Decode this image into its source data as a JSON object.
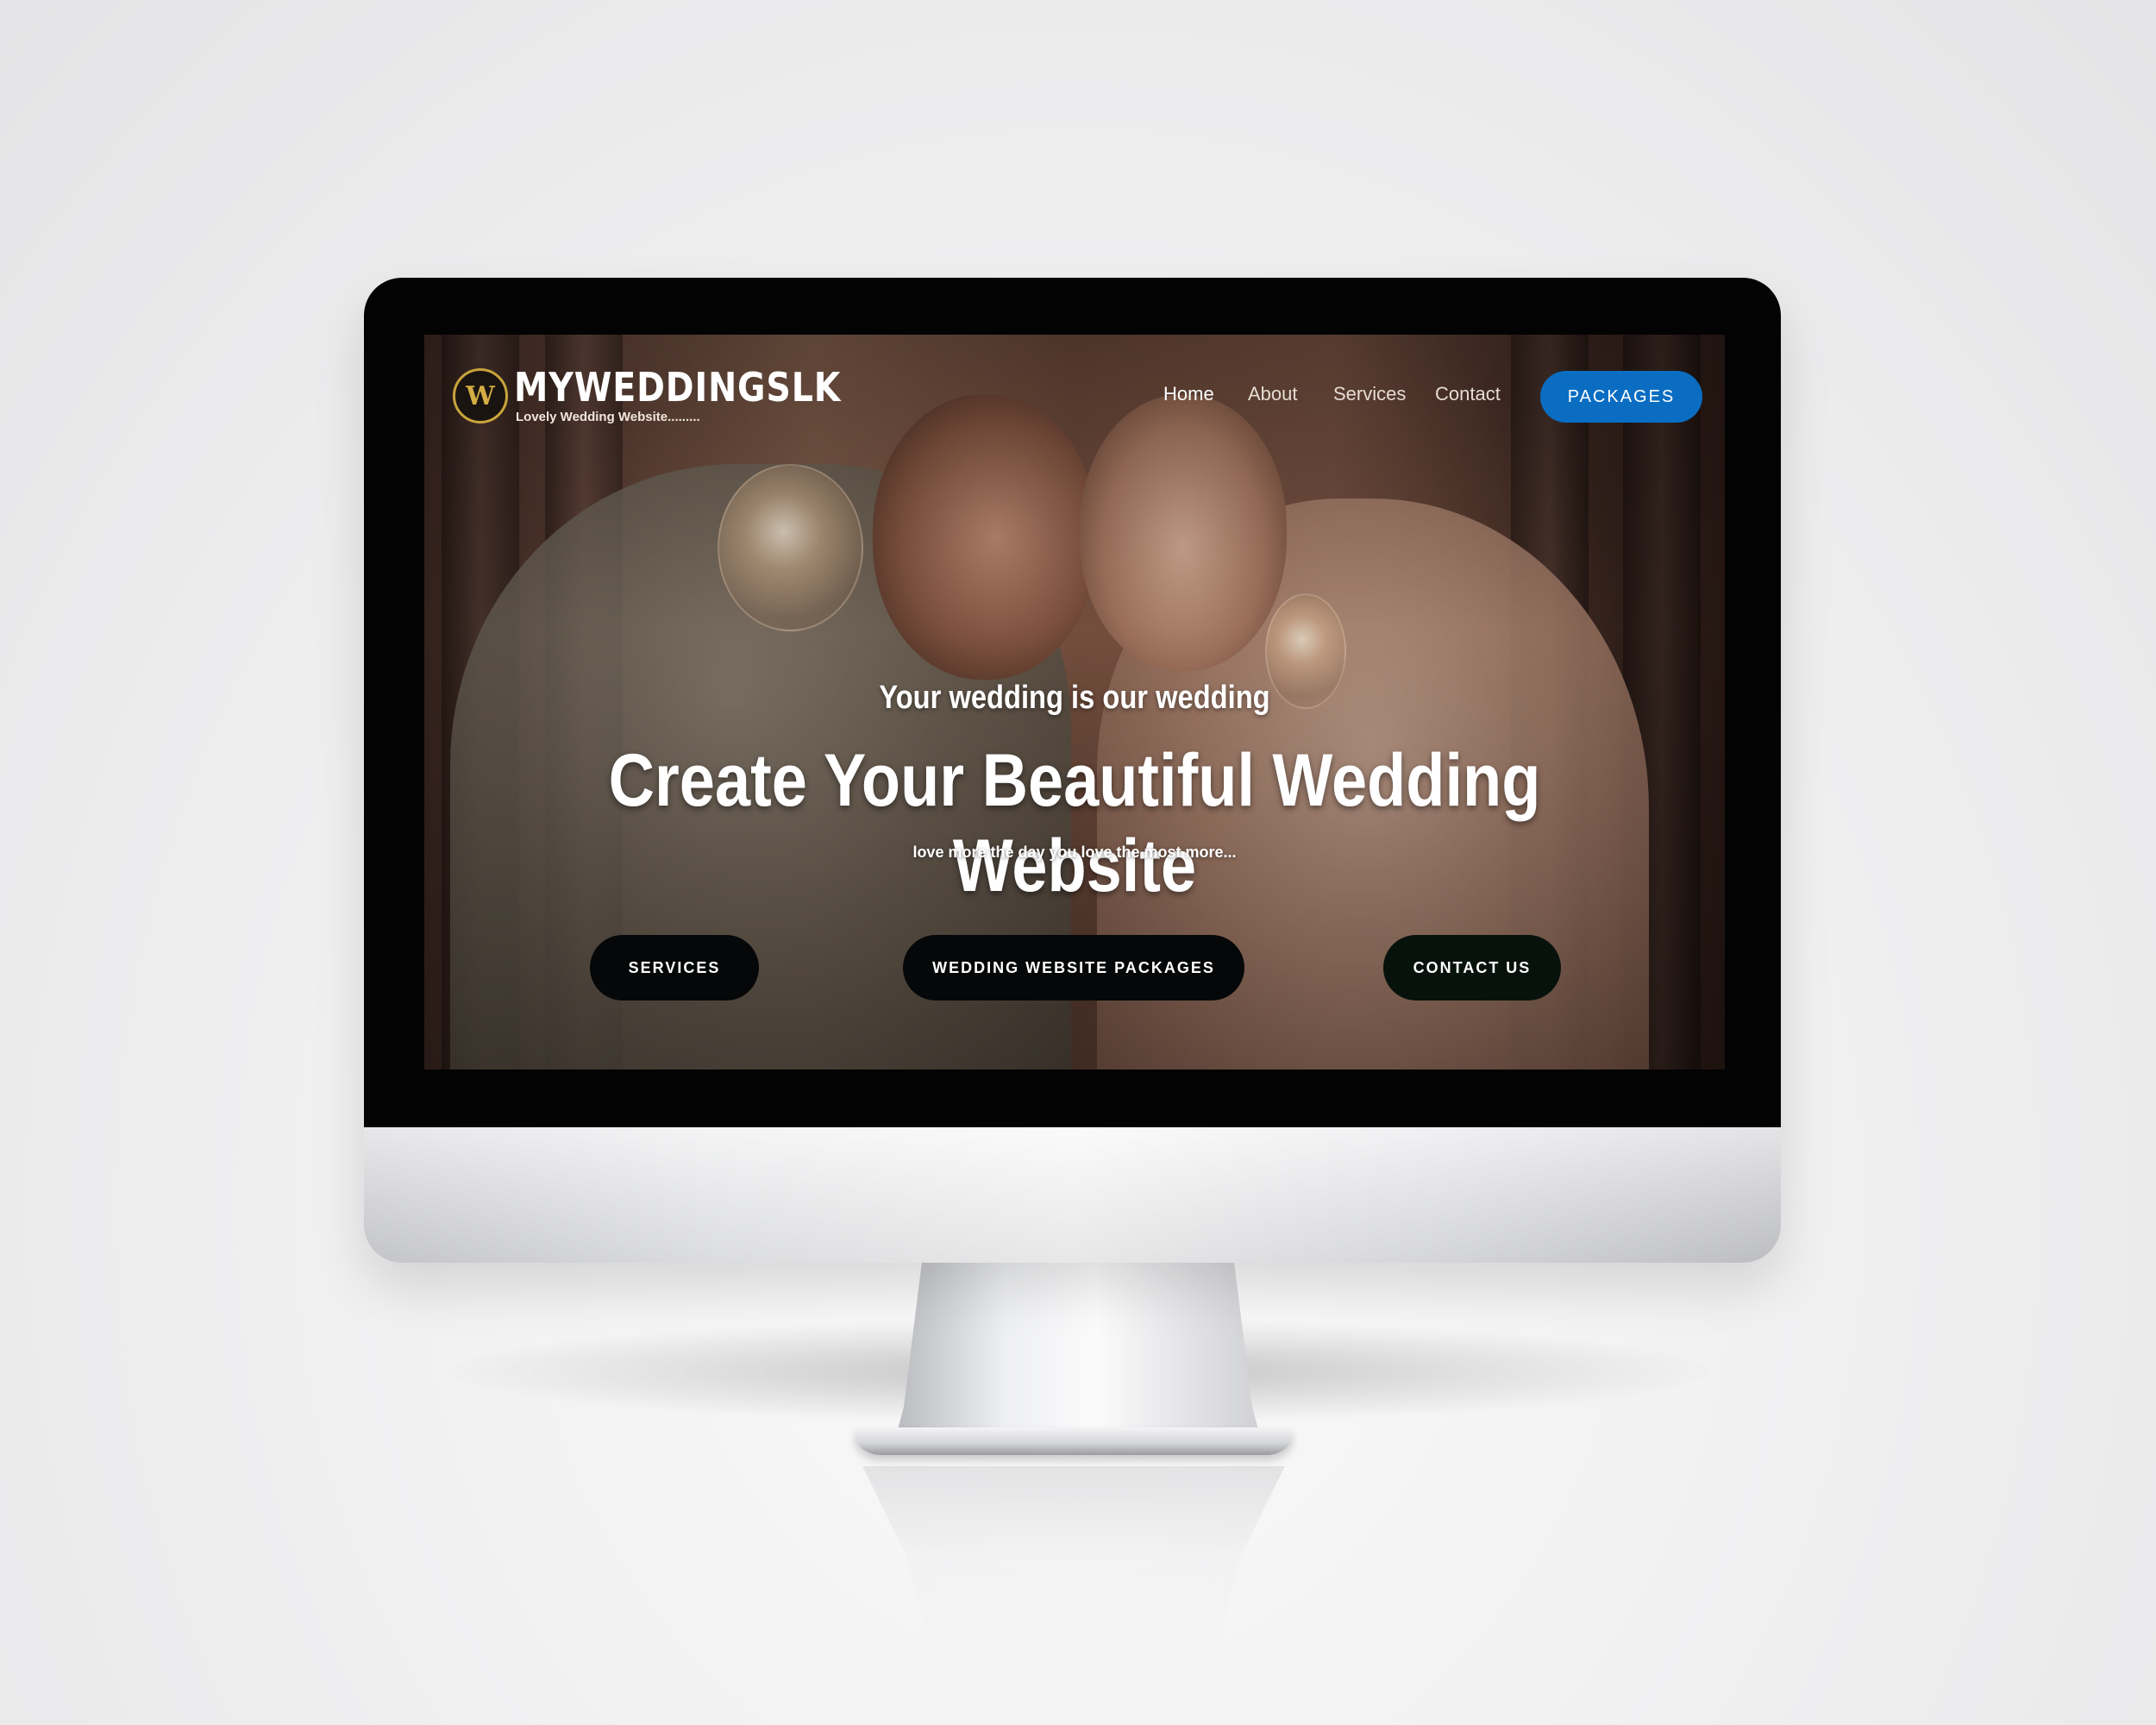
{
  "site": {
    "brand": "MYWEDDINGSLK",
    "tagline": "Lovely Wedding Website.........",
    "logo_icon": "w-monogram-icon"
  },
  "nav": {
    "items": [
      {
        "label": "Home"
      },
      {
        "label": "About"
      },
      {
        "label": "Services"
      },
      {
        "label": "Contact"
      }
    ],
    "cta_label": "PACKAGES"
  },
  "hero": {
    "subtitle": "Your wedding is our wedding",
    "title": "Create Your Beautiful Wedding Website",
    "tagline": "love more the day you love the most more...",
    "buttons": [
      {
        "label": "SERVICES"
      },
      {
        "label": "WEDDING WEBSITE PACKAGES"
      },
      {
        "label": "CONTACT US"
      }
    ]
  },
  "colors": {
    "accent_blue": "#0a6dc2",
    "logo_gold": "#c9a43c",
    "button_dark": "#050708"
  }
}
